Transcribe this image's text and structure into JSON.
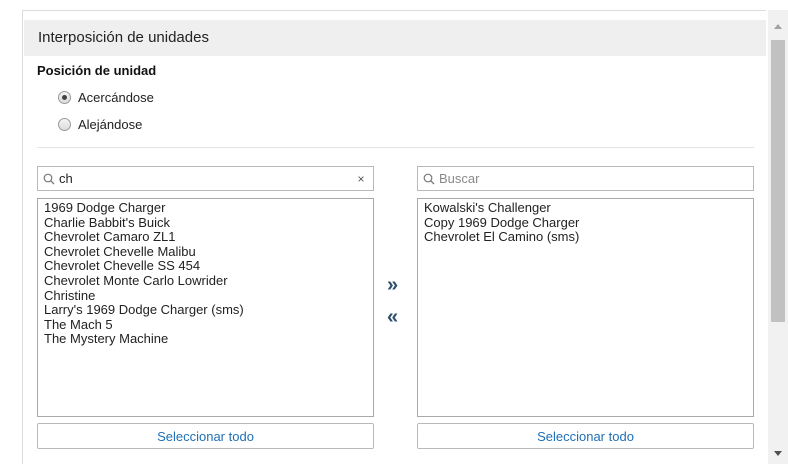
{
  "section": {
    "title": "Interposición de unidades"
  },
  "position": {
    "label": "Posición de unidad",
    "options": [
      {
        "label": "Acercándose",
        "checked": true
      },
      {
        "label": "Alejándose",
        "checked": false
      }
    ]
  },
  "left": {
    "search_value": "ch",
    "clear_symbol": "×",
    "items": [
      "1969 Dodge Charger",
      "Charlie Babbit's Buick",
      "Chevrolet Camaro ZL1",
      "Chevrolet Chevelle Malibu",
      "Chevrolet Chevelle SS 454",
      "Chevrolet Monte Carlo Lowrider",
      "Christine",
      "Larry's 1969 Dodge Charger (sms)",
      "The Mach 5",
      "The Mystery Machine"
    ],
    "select_all_label": "Seleccionar todo"
  },
  "transfer": {
    "add_symbol": "»",
    "remove_symbol": "«"
  },
  "right": {
    "search_placeholder": "Buscar",
    "items": [
      "Kowalski's Challenger",
      "Copy 1969 Dodge Charger",
      "Chevrolet El Camino (sms)"
    ],
    "select_all_label": "Seleccionar todo"
  },
  "colors": {
    "link": "#1f6fb5",
    "header_bg": "#efefef"
  },
  "icons": {
    "search": "search-icon",
    "clear": "close-icon",
    "add": "double-chevron-right-icon",
    "remove": "double-chevron-left-icon"
  }
}
